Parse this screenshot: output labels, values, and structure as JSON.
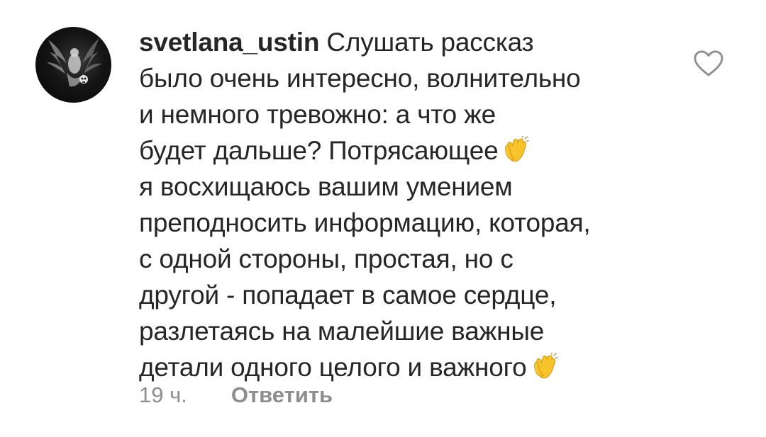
{
  "comment": {
    "username": "svetlana_ustin",
    "lines": [
      "Слушать рассказ",
      "было очень интересно, волнительно",
      "и немного тревожно: а что же",
      "будет дальше? Потрясающее",
      "я восхищаюсь вашим умением",
      "преподносить информацию, которая,",
      "с одной стороны, простая, но с",
      "другой - попадает в самое сердце,",
      "разлетаясь на малейшие важные",
      "детали одного целого и важного"
    ],
    "emoji": "clapping-hands",
    "timestamp": "19 ч.",
    "reply_label": "Ответить",
    "like_icon": "heart-outline-icon"
  },
  "colors": {
    "text": "#262626",
    "muted": "#8e8e8e",
    "emoji": "#f7c52b",
    "background": "#ffffff"
  }
}
